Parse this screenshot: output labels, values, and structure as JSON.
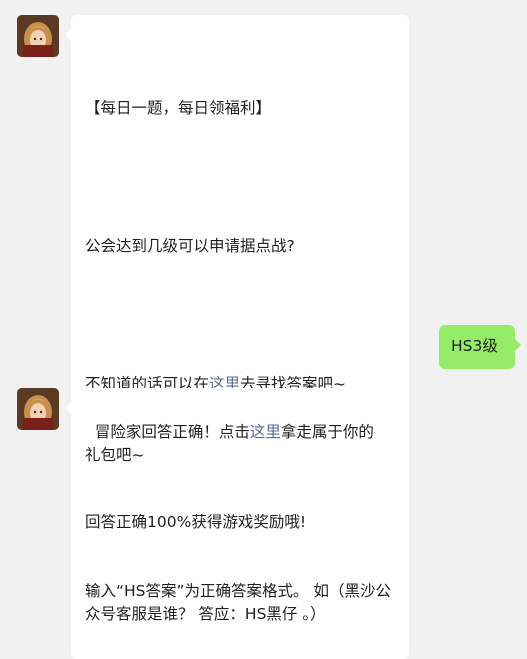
{
  "messages": {
    "first": {
      "avatar_icon": "game-character-avatar",
      "title": "【每日一题，每日领福利】",
      "question": "公会达到几级可以申请据点战?",
      "hint_before": "不知道的话可以在",
      "hint_link": "这里",
      "hint_after": "去寻找答案吧~",
      "reward_line": "回答正确100%获得游戏奖励哦!",
      "format_line": "输入“HS答案”为正确答案格式。 如（黑沙公众号客服是谁？ 答应：HS黑仔 。）"
    },
    "reply": {
      "text": "HS3级"
    },
    "second": {
      "avatar_icon": "game-character-avatar",
      "text_before": "冒险家回答正确！点击",
      "link": "这里",
      "text_after": "拿走属于你的礼包吧~"
    }
  },
  "colors": {
    "background": "#f1f1f1",
    "bubble_incoming": "#ffffff",
    "bubble_outgoing": "#95ec69",
    "link": "#576b95"
  }
}
